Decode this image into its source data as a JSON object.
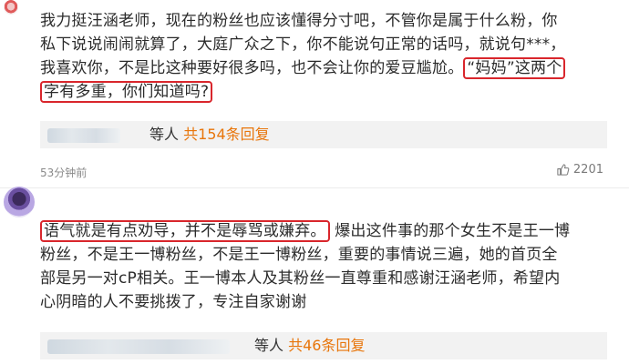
{
  "comments": [
    {
      "lines": [
        {
          "pre": "我力挺汪涵老师，现在的粉丝也应该懂得分寸吧，不管你是属于什么粉，你",
          "boxed": "",
          "post": ""
        },
        {
          "pre": "私下说说闹闹就算了，大庭广众之下，你不能说句正常的话吗，就说句***，",
          "boxed": "",
          "post": ""
        },
        {
          "pre": "我喜欢你，不是比这种要好很多吗，也不会让你的爱豆尴尬。",
          "boxed": "“妈妈”这两个",
          "post": ""
        },
        {
          "pre": "",
          "boxed": "字有多重，你们知道吗?",
          "post": ""
        }
      ],
      "reply_suffix": "等人",
      "reply_count": "共154条回复",
      "time": "53分钟前",
      "likes": "2201"
    },
    {
      "lines": [
        {
          "pre": "",
          "boxed": "语气就是有点劝导，并不是辱骂或嫌弃。",
          "post": "爆出这件事的那个女生不是王一博"
        },
        {
          "pre": "粉丝，不是王一博粉丝，不是王一博粉丝，重要的事情说三遍，她的首页全",
          "boxed": "",
          "post": ""
        },
        {
          "pre": "部是另一对cP相关。王一博本人及其粉丝一直尊重和感谢汪涵老师，希望内",
          "boxed": "",
          "post": ""
        },
        {
          "pre": "心阴暗的人不要挑拨了，专注自家谢谢",
          "boxed": "",
          "post": ""
        }
      ],
      "reply_suffix": "等人",
      "reply_count": "共46条回复"
    }
  ],
  "colors": {
    "highlight_box": "#d9262c",
    "reply_count": "#e8750a"
  },
  "icons": {
    "like": "thumbs-up-icon"
  }
}
